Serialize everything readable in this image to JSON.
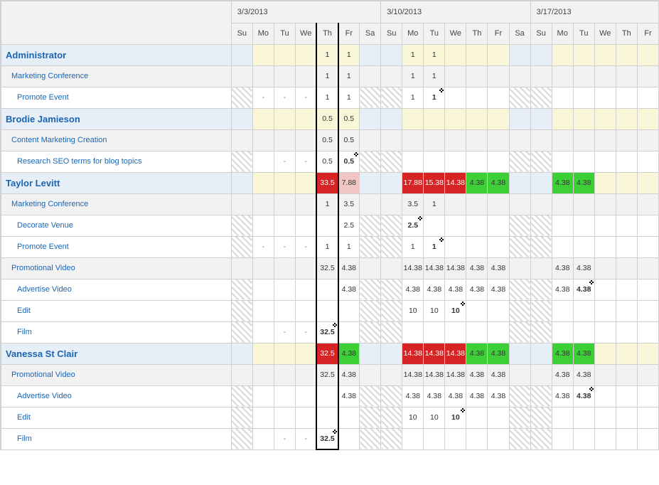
{
  "weeks": [
    "3/3/2013",
    "3/10/2013",
    "3/17/2013"
  ],
  "days": [
    "Su",
    "Mo",
    "Tu",
    "We",
    "Th",
    "Fr",
    "Sa",
    "Su",
    "Mo",
    "Tu",
    "We",
    "Th",
    "Fr",
    "Sa",
    "Su",
    "Mo",
    "Tu",
    "We",
    "Th",
    "Fr"
  ],
  "weekend_idx": [
    0,
    6,
    7,
    13,
    14
  ],
  "today_idx": 4,
  "rows": [
    {
      "type": "resource",
      "label": "Administrator",
      "cells": [
        {},
        {},
        {},
        {},
        {
          "v": "1",
          "cls": "soft-yellow"
        },
        {
          "v": "1",
          "cls": "soft-yellow"
        },
        {},
        {},
        {
          "v": "1",
          "cls": "soft-yellow"
        },
        {
          "v": "1",
          "cls": "soft-yellow"
        },
        {},
        {},
        {},
        {},
        {},
        {},
        {},
        {},
        {},
        {}
      ]
    },
    {
      "type": "summary",
      "label": "Marketing Conference",
      "cells": [
        {},
        {},
        {},
        {},
        {
          "v": "1"
        },
        {
          "v": "1"
        },
        {},
        {},
        {
          "v": "1"
        },
        {
          "v": "1"
        },
        {},
        {},
        {},
        {},
        {},
        {},
        {},
        {},
        {},
        {}
      ]
    },
    {
      "type": "assignment",
      "label": "Promote Event",
      "cells": [
        {},
        {
          "v": "-",
          "cls": "dash"
        },
        {
          "v": "-",
          "cls": "dash"
        },
        {
          "v": "-",
          "cls": "dash"
        },
        {
          "v": "1"
        },
        {
          "v": "1"
        },
        {},
        {},
        {
          "v": "1"
        },
        {
          "v": "1",
          "end": true
        },
        {},
        {},
        {},
        {},
        {},
        {},
        {},
        {},
        {},
        {}
      ]
    },
    {
      "type": "resource",
      "label": "Brodie Jamieson",
      "cells": [
        {},
        {},
        {},
        {},
        {
          "v": "0.5",
          "cls": "soft-yellow"
        },
        {
          "v": "0.5",
          "cls": "soft-yellow"
        },
        {},
        {},
        {},
        {},
        {},
        {},
        {},
        {},
        {},
        {},
        {},
        {},
        {},
        {}
      ]
    },
    {
      "type": "summary",
      "label": "Content Marketing Creation",
      "cells": [
        {},
        {},
        {},
        {},
        {
          "v": "0.5"
        },
        {
          "v": "0.5"
        },
        {},
        {},
        {},
        {},
        {},
        {},
        {},
        {},
        {},
        {},
        {},
        {},
        {},
        {}
      ]
    },
    {
      "type": "assignment",
      "label": "Research SEO terms for blog topics",
      "cells": [
        {},
        {},
        {
          "v": "-",
          "cls": "dash"
        },
        {
          "v": "-",
          "cls": "dash"
        },
        {
          "v": "0.5"
        },
        {
          "v": "0.5",
          "end": true
        },
        {},
        {},
        {},
        {},
        {},
        {},
        {},
        {},
        {},
        {},
        {},
        {},
        {},
        {}
      ]
    },
    {
      "type": "resource",
      "label": "Taylor Levitt",
      "cells": [
        {},
        {},
        {},
        {},
        {
          "v": "33.5",
          "cls": "hot-red"
        },
        {
          "v": "7.88",
          "cls": "hot-pink"
        },
        {},
        {},
        {
          "v": "17.88",
          "cls": "hot-red"
        },
        {
          "v": "15.38",
          "cls": "hot-red"
        },
        {
          "v": "14.38",
          "cls": "hot-red"
        },
        {
          "v": "4.38",
          "cls": "hot-green"
        },
        {
          "v": "4.38",
          "cls": "hot-green"
        },
        {},
        {},
        {
          "v": "4.38",
          "cls": "hot-green"
        },
        {
          "v": "4.38",
          "cls": "hot-green"
        },
        {},
        {},
        {}
      ]
    },
    {
      "type": "summary",
      "label": "Marketing Conference",
      "cells": [
        {},
        {},
        {},
        {},
        {
          "v": "1"
        },
        {
          "v": "3.5"
        },
        {},
        {},
        {
          "v": "3.5"
        },
        {
          "v": "1"
        },
        {},
        {},
        {},
        {},
        {},
        {},
        {},
        {},
        {},
        {}
      ]
    },
    {
      "type": "assignment",
      "label": "Decorate Venue",
      "cells": [
        {},
        {},
        {},
        {},
        {},
        {
          "v": "2.5"
        },
        {},
        {},
        {
          "v": "2.5",
          "end": true
        },
        {},
        {},
        {},
        {},
        {},
        {},
        {},
        {},
        {},
        {},
        {}
      ]
    },
    {
      "type": "assignment",
      "label": "Promote Event",
      "cells": [
        {},
        {
          "v": "-",
          "cls": "dash"
        },
        {
          "v": "-",
          "cls": "dash"
        },
        {
          "v": "-",
          "cls": "dash"
        },
        {
          "v": "1"
        },
        {
          "v": "1"
        },
        {},
        {},
        {
          "v": "1"
        },
        {
          "v": "1",
          "end": true
        },
        {},
        {},
        {},
        {},
        {},
        {},
        {},
        {},
        {},
        {}
      ]
    },
    {
      "type": "summary",
      "label": "Promotional Video",
      "cells": [
        {},
        {},
        {},
        {},
        {
          "v": "32.5"
        },
        {
          "v": "4.38"
        },
        {},
        {},
        {
          "v": "14.38"
        },
        {
          "v": "14.38"
        },
        {
          "v": "14.38"
        },
        {
          "v": "4.38"
        },
        {
          "v": "4.38"
        },
        {},
        {},
        {
          "v": "4.38"
        },
        {
          "v": "4.38"
        },
        {},
        {},
        {}
      ]
    },
    {
      "type": "assignment",
      "label": "Advertise Video",
      "cells": [
        {},
        {},
        {},
        {},
        {},
        {
          "v": "4.38"
        },
        {},
        {},
        {
          "v": "4.38"
        },
        {
          "v": "4.38"
        },
        {
          "v": "4.38"
        },
        {
          "v": "4.38"
        },
        {
          "v": "4.38"
        },
        {},
        {},
        {
          "v": "4.38"
        },
        {
          "v": "4.38",
          "end": true
        },
        {},
        {},
        {}
      ]
    },
    {
      "type": "assignment",
      "label": "Edit",
      "cells": [
        {},
        {},
        {},
        {},
        {},
        {},
        {},
        {},
        {
          "v": "10"
        },
        {
          "v": "10"
        },
        {
          "v": "10",
          "end": true
        },
        {},
        {},
        {},
        {},
        {},
        {},
        {},
        {},
        {}
      ]
    },
    {
      "type": "assignment",
      "label": "Film",
      "cells": [
        {},
        {},
        {
          "v": "-",
          "cls": "dash"
        },
        {
          "v": "-",
          "cls": "dash"
        },
        {
          "v": "32.5",
          "end": true
        },
        {},
        {},
        {},
        {},
        {},
        {},
        {},
        {},
        {},
        {},
        {},
        {},
        {},
        {},
        {}
      ]
    },
    {
      "type": "resource",
      "label": "Vanessa St Clair",
      "cells": [
        {},
        {},
        {},
        {},
        {
          "v": "32.5",
          "cls": "hot-red"
        },
        {
          "v": "4.38",
          "cls": "hot-green"
        },
        {},
        {},
        {
          "v": "14.38",
          "cls": "hot-red"
        },
        {
          "v": "14.38",
          "cls": "hot-red"
        },
        {
          "v": "14.38",
          "cls": "hot-red"
        },
        {
          "v": "4.38",
          "cls": "hot-green"
        },
        {
          "v": "4.38",
          "cls": "hot-green"
        },
        {},
        {},
        {
          "v": "4.38",
          "cls": "hot-green"
        },
        {
          "v": "4.38",
          "cls": "hot-green"
        },
        {},
        {},
        {}
      ]
    },
    {
      "type": "summary",
      "label": "Promotional Video",
      "cells": [
        {},
        {},
        {},
        {},
        {
          "v": "32.5"
        },
        {
          "v": "4.38"
        },
        {},
        {},
        {
          "v": "14.38"
        },
        {
          "v": "14.38"
        },
        {
          "v": "14.38"
        },
        {
          "v": "4.38"
        },
        {
          "v": "4.38"
        },
        {},
        {},
        {
          "v": "4.38"
        },
        {
          "v": "4.38"
        },
        {},
        {},
        {}
      ]
    },
    {
      "type": "assignment",
      "label": "Advertise Video",
      "cells": [
        {},
        {},
        {},
        {},
        {},
        {
          "v": "4.38"
        },
        {},
        {},
        {
          "v": "4.38"
        },
        {
          "v": "4.38"
        },
        {
          "v": "4.38"
        },
        {
          "v": "4.38"
        },
        {
          "v": "4.38"
        },
        {},
        {},
        {
          "v": "4.38"
        },
        {
          "v": "4.38",
          "end": true
        },
        {},
        {},
        {}
      ]
    },
    {
      "type": "assignment",
      "label": "Edit",
      "cells": [
        {},
        {},
        {},
        {},
        {},
        {},
        {},
        {},
        {
          "v": "10"
        },
        {
          "v": "10"
        },
        {
          "v": "10",
          "end": true
        },
        {},
        {},
        {},
        {},
        {},
        {},
        {},
        {},
        {}
      ]
    },
    {
      "type": "assignment",
      "label": "Film",
      "cells": [
        {},
        {},
        {
          "v": "-",
          "cls": "dash"
        },
        {
          "v": "-",
          "cls": "dash"
        },
        {
          "v": "32.5",
          "end": true
        },
        {},
        {},
        {},
        {},
        {},
        {},
        {},
        {},
        {},
        {},
        {},
        {},
        {},
        {},
        {}
      ]
    }
  ]
}
